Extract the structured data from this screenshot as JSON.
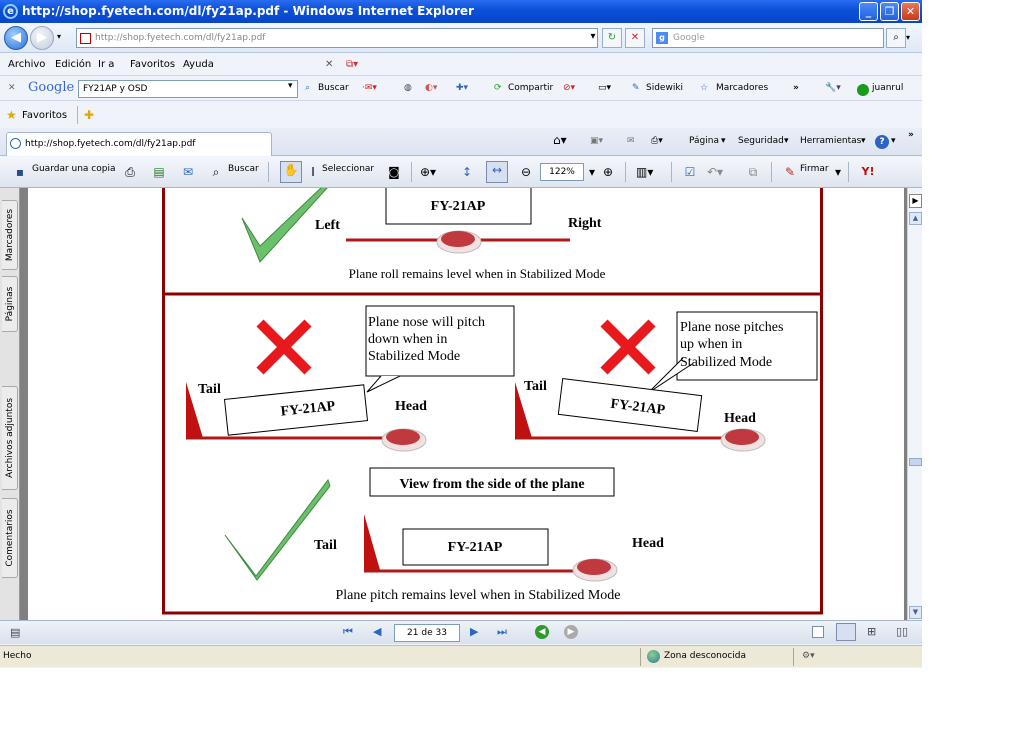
{
  "window": {
    "title": "http://shop.fyetech.com/dl/fy21ap.pdf - Windows Internet Explorer",
    "controls": {
      "minimize": "_",
      "maximize": "❐",
      "close": "✕"
    }
  },
  "address_bar": {
    "url": "http://shop.fyetech.com/dl/fy21ap.pdf",
    "search_placeholder": "Google"
  },
  "menu": {
    "items": [
      "Archivo",
      "Edición",
      "Ir a",
      "Favoritos",
      "Ayuda"
    ]
  },
  "google_toolbar": {
    "logo": "Google",
    "query": "FY21AP y OSD",
    "buscar": "Buscar",
    "compartir": "Compartir",
    "sidewiki": "Sidewiki",
    "marcadores": "Marcadores",
    "user": "juanrul"
  },
  "favorites_bar": {
    "label": "Favoritos"
  },
  "tab": {
    "label": "http://shop.fyetech.com/dl/fy21ap.pdf"
  },
  "command_bar": {
    "pagina": "Página",
    "seguridad": "Seguridad",
    "herramientas": "Herramientas"
  },
  "pdf_toolbar": {
    "save_copy": "Guardar una copia",
    "search": "Buscar",
    "select": "Seleccionar",
    "zoom": "122%",
    "sign": "Firmar"
  },
  "side_tabs": [
    "Marcadores",
    "Páginas",
    "Archivos adjuntos",
    "Comentarios"
  ],
  "pdf_nav": {
    "page": "21 de 33"
  },
  "status_bar": {
    "left": "Hecho",
    "zone": "Zona desconocida"
  },
  "document": {
    "top": {
      "label_left": "Left",
      "label_right": "Right",
      "model": "FY-21AP",
      "caption": "Plane roll remains level when in Stabilized Mode"
    },
    "left_diagram": {
      "callout": [
        "Plane nose will pitch",
        "down when in",
        "Stabilized Mode"
      ],
      "tail": "Tail",
      "head": "Head",
      "model": "FY-21AP"
    },
    "right_diagram": {
      "callout": [
        "Plane nose pitches",
        "up when in",
        "Stabilized Mode"
      ],
      "tail": "Tail",
      "head": "Head",
      "model": "FY-21AP"
    },
    "view_label": "View from the side of the plane",
    "bottom": {
      "tail": "Tail",
      "head": "Head",
      "model": "FY-21AP",
      "caption": "Plane pitch remains level when in Stabilized Mode"
    }
  }
}
